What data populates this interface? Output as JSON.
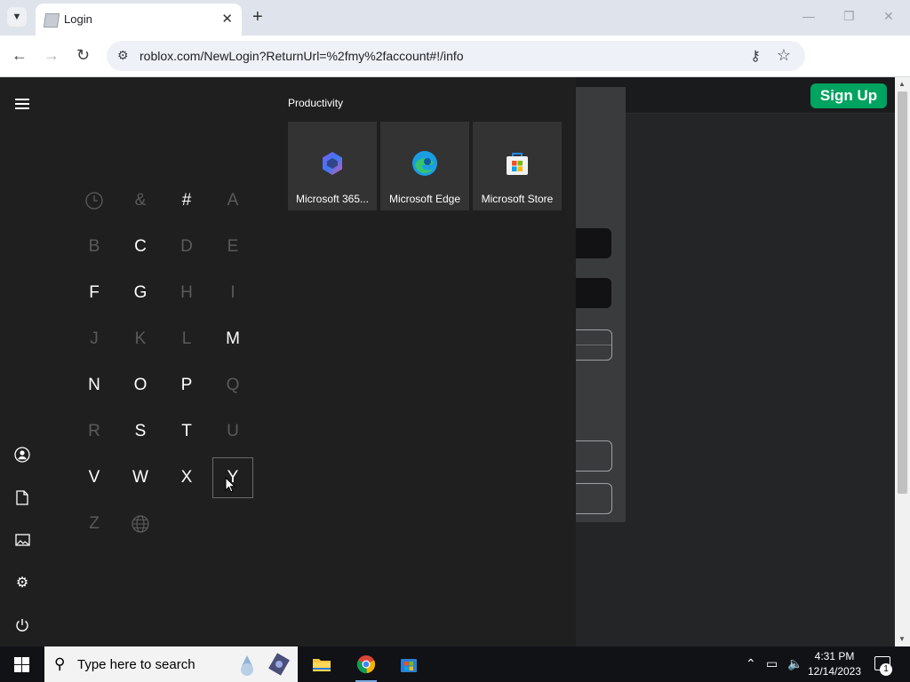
{
  "browser": {
    "tab_title": "Login",
    "url": "roblox.com/NewLogin?ReturnUrl=%2fmy%2faccount#!/info"
  },
  "page": {
    "signup_label": "Sign Up"
  },
  "start_menu": {
    "letters": [
      {
        "label": "clock",
        "active": false,
        "icon": true
      },
      {
        "label": "&",
        "active": false
      },
      {
        "label": "#",
        "active": true
      },
      {
        "label": "A",
        "active": false
      },
      {
        "label": "B",
        "active": false
      },
      {
        "label": "C",
        "active": true
      },
      {
        "label": "D",
        "active": false
      },
      {
        "label": "E",
        "active": false
      },
      {
        "label": "F",
        "active": true
      },
      {
        "label": "G",
        "active": true
      },
      {
        "label": "H",
        "active": false
      },
      {
        "label": "I",
        "active": false
      },
      {
        "label": "J",
        "active": false
      },
      {
        "label": "K",
        "active": false
      },
      {
        "label": "L",
        "active": false
      },
      {
        "label": "M",
        "active": true
      },
      {
        "label": "N",
        "active": true
      },
      {
        "label": "O",
        "active": true
      },
      {
        "label": "P",
        "active": true
      },
      {
        "label": "Q",
        "active": false
      },
      {
        "label": "R",
        "active": false
      },
      {
        "label": "S",
        "active": true
      },
      {
        "label": "T",
        "active": true
      },
      {
        "label": "U",
        "active": false
      },
      {
        "label": "V",
        "active": true
      },
      {
        "label": "W",
        "active": true
      },
      {
        "label": "X",
        "active": true
      },
      {
        "label": "Y",
        "active": true,
        "selected": true
      },
      {
        "label": "Z",
        "active": false
      },
      {
        "label": "globe",
        "active": false,
        "icon": true
      }
    ],
    "group_title": "Productivity",
    "tiles": [
      {
        "label": "Microsoft 365..."
      },
      {
        "label": "Microsoft Edge"
      },
      {
        "label": "Microsoft Store"
      }
    ]
  },
  "taskbar": {
    "search_placeholder": "Type here to search",
    "time": "4:31 PM",
    "date": "12/14/2023",
    "notification_count": "1"
  }
}
